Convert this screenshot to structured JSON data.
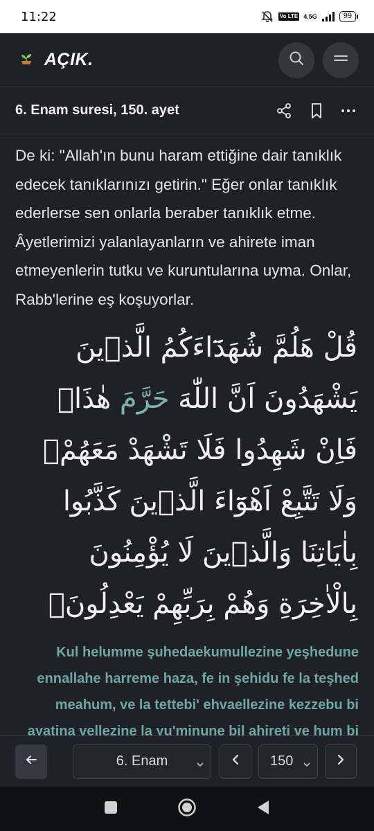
{
  "status": {
    "time": "11:22",
    "network_tag": "Vo LTE",
    "network_speed": "4.5G",
    "battery": "99"
  },
  "header": {
    "logo_text": "AÇIK.",
    "logo_icon": "sprout-icon",
    "search_icon": "search-icon",
    "menu_icon": "menu-icon"
  },
  "title_bar": {
    "title": "6. Enam suresi, 150. ayet",
    "actions": [
      "share-icon",
      "bookmark-icon",
      "more-icon"
    ]
  },
  "content": {
    "translation": "De ki: \"Allah'ın bunu haram ettiğine dair tanıklık edecek tanıklarınızı getirin.\" Eğer onlar tanıklık ederlerse sen onlarla beraber tanıklık etme. Âyetlerimizi yalanlayanların ve ahirete iman etmeyenlerin tutku ve kuruntularına uyma. Onlar, Rabb'lerine eş koşuyorlar.",
    "arabic_before": "قُلْ هَلُمَّ شُهَدَٓاءَكُمُ الَّذ۪ينَ يَشْهَدُونَ اَنَّ اللّٰهَ ",
    "arabic_highlight": "حَرَّمَ",
    "arabic_after": " هٰذَاۚ فَاِنْ شَهِدُوا فَلَا تَشْهَدْ مَعَهُمْۚ وَلَا تَتَّبِعْ اَهْوَٓاءَ الَّذ۪ينَ كَذَّبُوا بِاٰيَاتِنَا وَالَّذ۪ينَ لَا يُؤْمِنُونَ بِالْاٰخِرَةِ وَهُمْ بِرَبِّهِمْ يَعْدِلُونَ۟",
    "transliteration": "Kul helumme şuhedaekumullezine yeşhedune ennallahe harreme haza, fe in şehidu fe la teşhed meahum, ve la tettebi' ehvaellezine kezzebu bi ayatina vellezine la yu'minune bil ahireti ve hum bi rabbihim ya'dilun."
  },
  "bottom_nav": {
    "sura_value": "6. Enam",
    "ayah_value": "150",
    "icons": [
      "arrow-left-icon",
      "chevron-left-icon",
      "chevron-right-icon"
    ]
  },
  "colors": {
    "background": "#1f2126",
    "accent_teal": "#6ea6a6",
    "button_bg": "#33363d"
  }
}
